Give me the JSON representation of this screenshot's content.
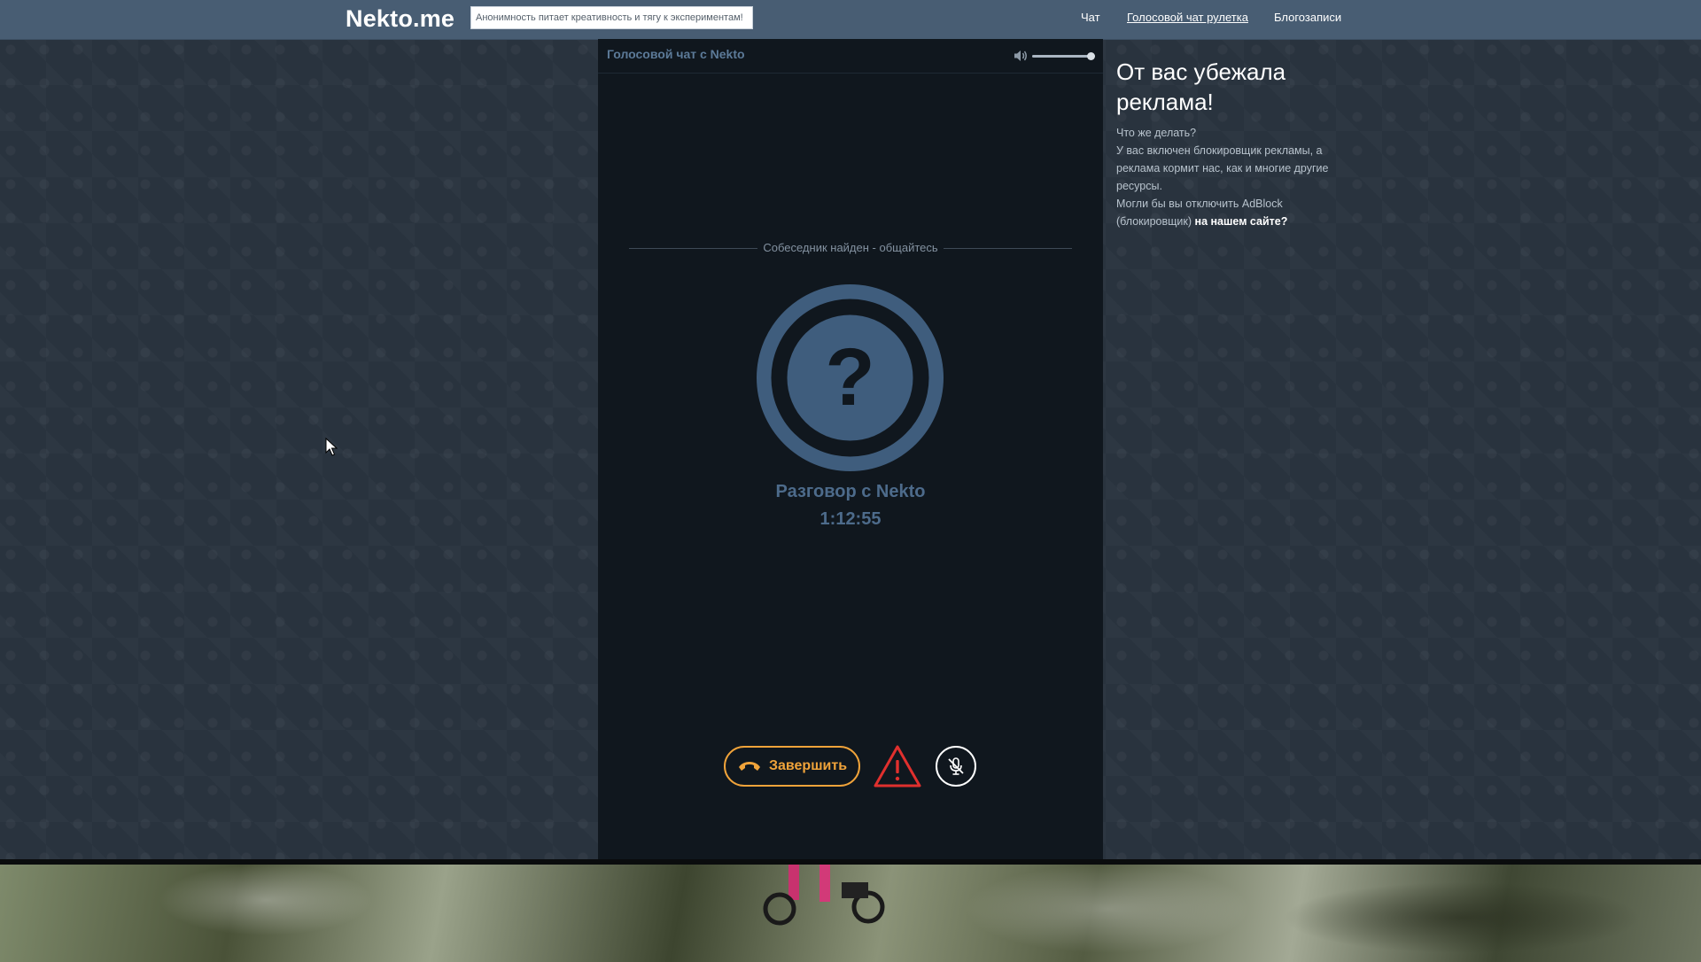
{
  "header": {
    "logo": "Nekto.me",
    "slogan": "Анонимность питает креативность и тягу к экспериментам!",
    "nav": {
      "chat": "Чат",
      "voice_roulette": "Голосовой чат рулетка",
      "blog": "Блогозаписи"
    }
  },
  "panel": {
    "title": "Голосовой чат с Nekto",
    "volume": 1.0,
    "status": "Собеседник найден - общайтесь",
    "avatar_symbol": "?",
    "talk_title": "Разговор с Nekto",
    "timer": "1:12:55",
    "end_button": "Завершить"
  },
  "ad_notice": {
    "title": "От вас убежала реклама!",
    "line1": "Что же делать?",
    "line2": "У вас включен блокировщик рекламы, а реклама кормит нас, как и многие другие ресурсы.",
    "line3_prefix": "Могли бы вы отключить AdBlock (блокировщик)",
    "line3_link": "на нашем сайте?"
  },
  "colors": {
    "topbar": "#485d73",
    "panel_bg": "#10171e",
    "accent_blue": "#4d6b8b",
    "end_orange": "#f0a33a",
    "warning_red": "#e0302e"
  }
}
